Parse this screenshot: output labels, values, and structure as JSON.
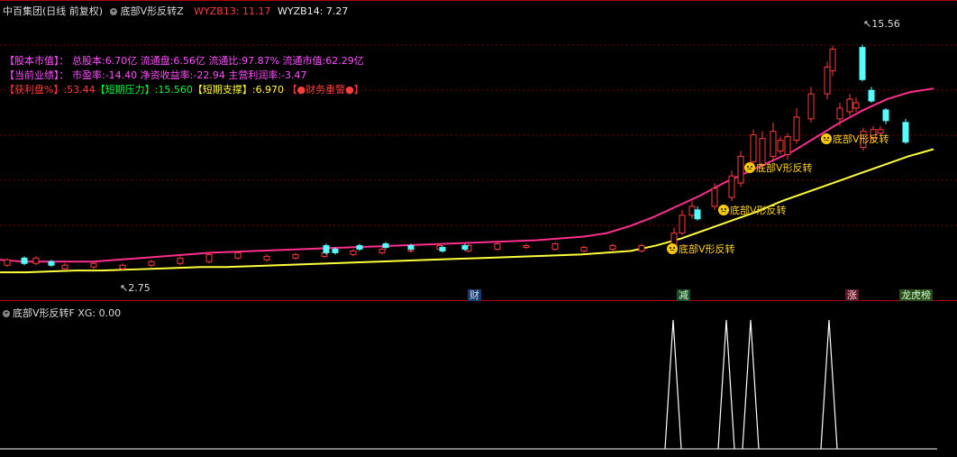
{
  "header": {
    "stock_name": "中百集团(日线 前复权)",
    "indicator_name": "底部V形反转Z",
    "wyzb13": "WYZB13: 11.17",
    "wyzb14": "WYZB14: 7.27"
  },
  "finance": {
    "line1": "【股本市值】：  总股本:6.70亿 流通盘:6.56亿 流通比:97.87% 流通市值:62.29亿",
    "line2": "【当前业绩】：  市盈率:-14.40 净资收益率:-22.94 主营利润率:-3.47",
    "line3_a": "【获利盘%】:53.44",
    "line3_b": "【短期压力】:15.560",
    "line3_c": "【短期支撑】:6.970",
    "line3_d": "【●财务重警●】"
  },
  "price_labels": {
    "high": "15.56",
    "low": "2.75"
  },
  "signals": [
    "底部V形反转",
    "底部V形反转",
    "底部V形反转",
    "底部V形反转"
  ],
  "events": [
    "财",
    "减",
    "涨",
    "龙虎榜"
  ],
  "sub": {
    "header": "底部V形反转F  XG: 0.00"
  },
  "colors": {
    "up": "#ff3c3c",
    "down": "#54ffff",
    "ma_short": "#ff2f8f",
    "ma_long": "#ffff3c",
    "grid": "#7a0000",
    "signal_text": "#ffd21c",
    "finance_magenta": "#ff50ff",
    "finance_green": "#00ff40",
    "finance_red": "#ff3c3c"
  },
  "chart_data": {
    "type": "candlestick",
    "y_range": [
      2.0,
      17.2
    ],
    "annotated_high": 15.56,
    "annotated_low": 2.75,
    "candles_up": [
      [
        3.2,
        3.5,
        3.6,
        3.1
      ],
      [
        3.3,
        3.6,
        3.7,
        3.2
      ],
      [
        3.0,
        3.2,
        3.3,
        2.9
      ],
      [
        3.1,
        3.3,
        3.4,
        3.0
      ],
      [
        3.0,
        3.2,
        3.3,
        2.9
      ],
      [
        3.2,
        3.4,
        3.5,
        3.1
      ],
      [
        3.3,
        3.6,
        3.7,
        3.2
      ],
      [
        3.4,
        3.8,
        3.9,
        3.3
      ],
      [
        3.6,
        3.9,
        4.0,
        3.5
      ],
      [
        3.5,
        3.7,
        3.8,
        3.4
      ],
      [
        3.6,
        3.8,
        3.9,
        3.5
      ],
      [
        3.7,
        3.9,
        4.0,
        3.6
      ],
      [
        3.8,
        4.0,
        4.1,
        3.7
      ],
      [
        3.9,
        4.1,
        4.2,
        3.8
      ],
      [
        4.0,
        4.2,
        4.3,
        3.9
      ],
      [
        4.1,
        4.3,
        4.4,
        4.0
      ],
      [
        4.0,
        4.3,
        4.4,
        3.9
      ],
      [
        4.1,
        4.4,
        4.5,
        4.0
      ],
      [
        4.2,
        4.3,
        4.4,
        4.1
      ],
      [
        4.1,
        4.4,
        4.5,
        4.0
      ],
      [
        4.0,
        4.2,
        4.3,
        3.9
      ],
      [
        4.1,
        4.3,
        4.4,
        4.0
      ],
      [
        4.0,
        4.3,
        4.4,
        3.9
      ],
      [
        4.3,
        5.0,
        5.3,
        4.2
      ],
      [
        5.0,
        6.0,
        6.3,
        4.9
      ],
      [
        6.0,
        6.5,
        6.8,
        5.8
      ],
      [
        6.5,
        7.5,
        7.8,
        6.3
      ],
      [
        7.0,
        8.2,
        8.5,
        6.8
      ],
      [
        7.8,
        9.3,
        9.6,
        7.6
      ],
      [
        9.0,
        10.5,
        10.8,
        8.8
      ],
      [
        8.8,
        10.3,
        10.7,
        8.5
      ],
      [
        9.3,
        10.7,
        11.2,
        9.0
      ],
      [
        9.6,
        10.2,
        10.4,
        9.4
      ],
      [
        9.4,
        10.4,
        10.6,
        9.1
      ],
      [
        10.2,
        11.5,
        12.0,
        10.0
      ],
      [
        11.4,
        12.8,
        13.2,
        11.2
      ],
      [
        12.8,
        14.3,
        14.6,
        12.5
      ],
      [
        14.1,
        15.3,
        15.5,
        13.8
      ],
      [
        11.4,
        12.0,
        12.3,
        11.0
      ],
      [
        11.8,
        12.5,
        12.8,
        11.6
      ],
      [
        12.0,
        12.3,
        12.6,
        11.8
      ],
      [
        9.8,
        10.7,
        10.9,
        9.6
      ],
      [
        10.3,
        10.8,
        11.0,
        10.1
      ],
      [
        10.6,
        10.8,
        11.0,
        10.5
      ]
    ],
    "candles_down": [
      [
        3.6,
        3.3,
        3.7,
        3.2
      ],
      [
        3.4,
        3.2,
        3.5,
        3.1
      ],
      [
        4.3,
        3.9,
        4.4,
        3.8
      ],
      [
        4.1,
        3.9,
        4.2,
        3.8
      ],
      [
        4.3,
        4.1,
        4.4,
        4.0
      ],
      [
        4.4,
        4.2,
        4.5,
        4.1
      ],
      [
        4.3,
        4.1,
        4.4,
        4.0
      ],
      [
        4.2,
        4.0,
        4.3,
        3.9
      ],
      [
        4.3,
        4.1,
        4.4,
        4.0
      ],
      [
        6.3,
        5.8,
        6.5,
        5.7
      ],
      [
        15.4,
        13.6,
        15.56,
        13.5
      ],
      [
        13.0,
        12.4,
        13.2,
        12.3
      ],
      [
        11.9,
        11.3,
        12.0,
        11.1
      ],
      [
        11.2,
        10.1,
        11.4,
        10.0
      ]
    ],
    "ma_short": [
      [
        3.5,
        3.4,
        3.4,
        3.4,
        3.4,
        3.5,
        3.6,
        3.7,
        3.8,
        3.9,
        3.95,
        4.0,
        4.05,
        4.1,
        4.15,
        4.2,
        4.25,
        4.3,
        4.35,
        4.4,
        4.45,
        4.5,
        4.55,
        4.6,
        4.7,
        4.8,
        5.0,
        5.4,
        5.9,
        6.5,
        7.1,
        7.8,
        8.4,
        9.0,
        9.6,
        10.4,
        11.2,
        11.9,
        12.5,
        12.9,
        13.1
      ]
    ],
    "ma_long": [
      [
        2.8,
        2.8,
        2.85,
        2.9,
        2.9,
        2.95,
        3.0,
        3.05,
        3.1,
        3.1,
        3.15,
        3.2,
        3.25,
        3.3,
        3.35,
        3.4,
        3.45,
        3.5,
        3.55,
        3.6,
        3.65,
        3.7,
        3.75,
        3.8,
        3.9,
        4.0,
        4.3,
        4.7,
        5.2,
        5.7,
        6.2,
        6.8,
        7.3,
        7.8,
        8.3,
        8.8,
        9.3,
        9.7
      ]
    ],
    "sub_series": {
      "name": "XG",
      "value": 0.0,
      "peaks": [
        1,
        1,
        1,
        1
      ]
    }
  }
}
